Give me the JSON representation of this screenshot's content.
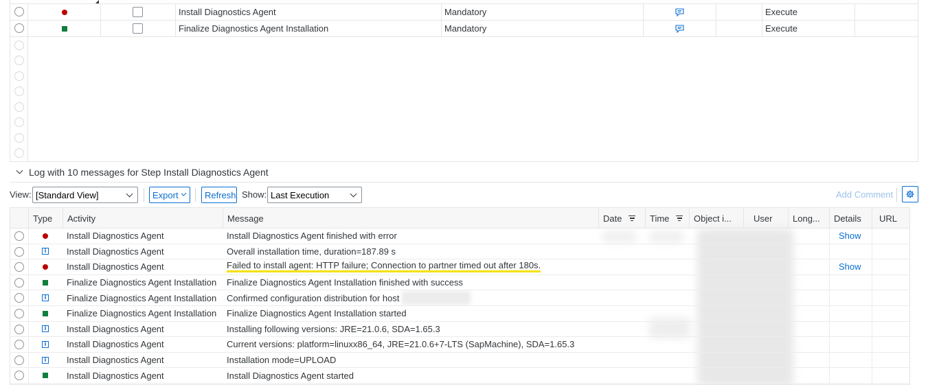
{
  "steps": [
    {
      "status": "error",
      "name": "Install Diagnostics Agent",
      "type": "Mandatory",
      "action": "Execute"
    },
    {
      "status": "success",
      "name": "Finalize Diagnostics Agent Installation",
      "type": "Mandatory",
      "action": "Execute"
    }
  ],
  "log": {
    "title": "Log with 10 messages for Step Install Diagnostics Agent",
    "toolbar": {
      "view_label": "View:",
      "view_value": "[Standard View]",
      "export_label": "Export",
      "refresh_label": "Refresh",
      "show_label": "Show:",
      "show_value": "Last Execution",
      "add_comment_label": "Add Comment"
    },
    "columns": [
      "Type",
      "Activity",
      "Message",
      "Date",
      "Time",
      "Object i...",
      "User",
      "Long...",
      "Details",
      "URL"
    ],
    "rows": [
      {
        "type": "error",
        "activity": "Install Diagnostics Agent",
        "message": "Install Diagnostics Agent finished with error",
        "details": "Show"
      },
      {
        "type": "info",
        "activity": "Install Diagnostics Agent",
        "message": "Overall installation time, duration=187.89 s",
        "details": ""
      },
      {
        "type": "error",
        "activity": "Install Diagnostics Agent",
        "message": "Failed to install agent: HTTP failure; Connection to partner timed out after 180s.",
        "details": "Show"
      },
      {
        "type": "success",
        "activity": "Finalize Diagnostics Agent Installation",
        "message": "Finalize Diagnostics Agent Installation finished with success",
        "details": ""
      },
      {
        "type": "info",
        "activity": "Finalize Diagnostics Agent Installation",
        "message": "Confirmed configuration distribution for host",
        "details": ""
      },
      {
        "type": "success",
        "activity": "Finalize Diagnostics Agent Installation",
        "message": "Finalize Diagnostics Agent Installation started",
        "details": ""
      },
      {
        "type": "info",
        "activity": "Install Diagnostics Agent",
        "message": "Installing following versions: JRE=21.0.6, SDA=1.65.3",
        "details": ""
      },
      {
        "type": "info",
        "activity": "Install Diagnostics Agent",
        "message": "Current versions: platform=linuxx86_64, JRE=21.0.6+7-LTS (SapMachine), SDA=1.65.3",
        "details": ""
      },
      {
        "type": "info",
        "activity": "Install Diagnostics Agent",
        "message": "Installation mode=UPLOAD",
        "details": ""
      },
      {
        "type": "success",
        "activity": "Install Diagnostics Agent",
        "message": "Install Diagnostics Agent started",
        "details": ""
      }
    ]
  },
  "colors": {
    "error": "#bb0000",
    "success": "#107e3e",
    "info": "#0a6ed1",
    "highlight": "#f5e000"
  }
}
